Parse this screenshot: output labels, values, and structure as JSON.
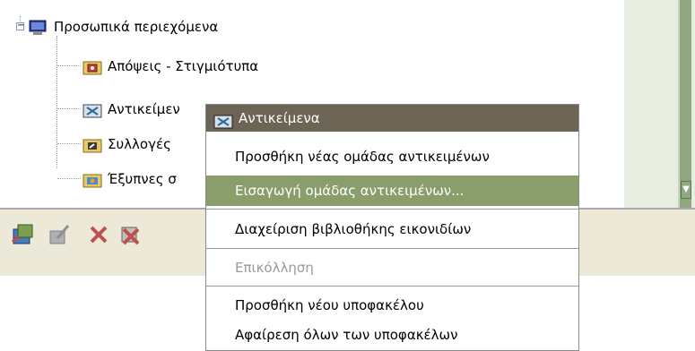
{
  "tree": {
    "root": {
      "label": "Προσωπικά περιεχόμενα",
      "icon": "computer-icon"
    },
    "children": [
      {
        "label": "Απόψεις - Στιγμιότυπα",
        "icon": "snapshot-folder-icon"
      },
      {
        "label": "Αντικείμεν",
        "icon": "objects-folder-icon"
      },
      {
        "label": "Συλλογές",
        "icon": "collections-folder-icon"
      },
      {
        "label": "Έξυπνες σ",
        "icon": "smart-folder-icon"
      }
    ],
    "expander_symbol": "−"
  },
  "context_menu": {
    "title": "Αντικείμενα",
    "items": [
      {
        "label": "Προσθήκη νέας ομάδας αντικειμένων",
        "state": "normal"
      },
      {
        "label": "Εισαγωγή ομάδας αντικειμένων...",
        "state": "selected"
      },
      {
        "label": "Διαχείριση βιβλιοθήκης εικονιδίων",
        "state": "normal"
      },
      {
        "label": "Επικόλληση",
        "state": "disabled"
      },
      {
        "label": "Προσθήκη νέου υποφακέλου",
        "state": "normal"
      },
      {
        "label": "Αφαίρεση όλων των υποφακέλων",
        "state": "normal"
      }
    ]
  },
  "toolbar": {
    "buttons": [
      "new-collection-icon",
      "edit-icon",
      "delete-icon",
      "delete-all-icon"
    ]
  },
  "colors": {
    "menu_title_bg": "#6c6454",
    "menu_selected_bg": "#8a9e6c",
    "panel_green": "#90a880"
  }
}
